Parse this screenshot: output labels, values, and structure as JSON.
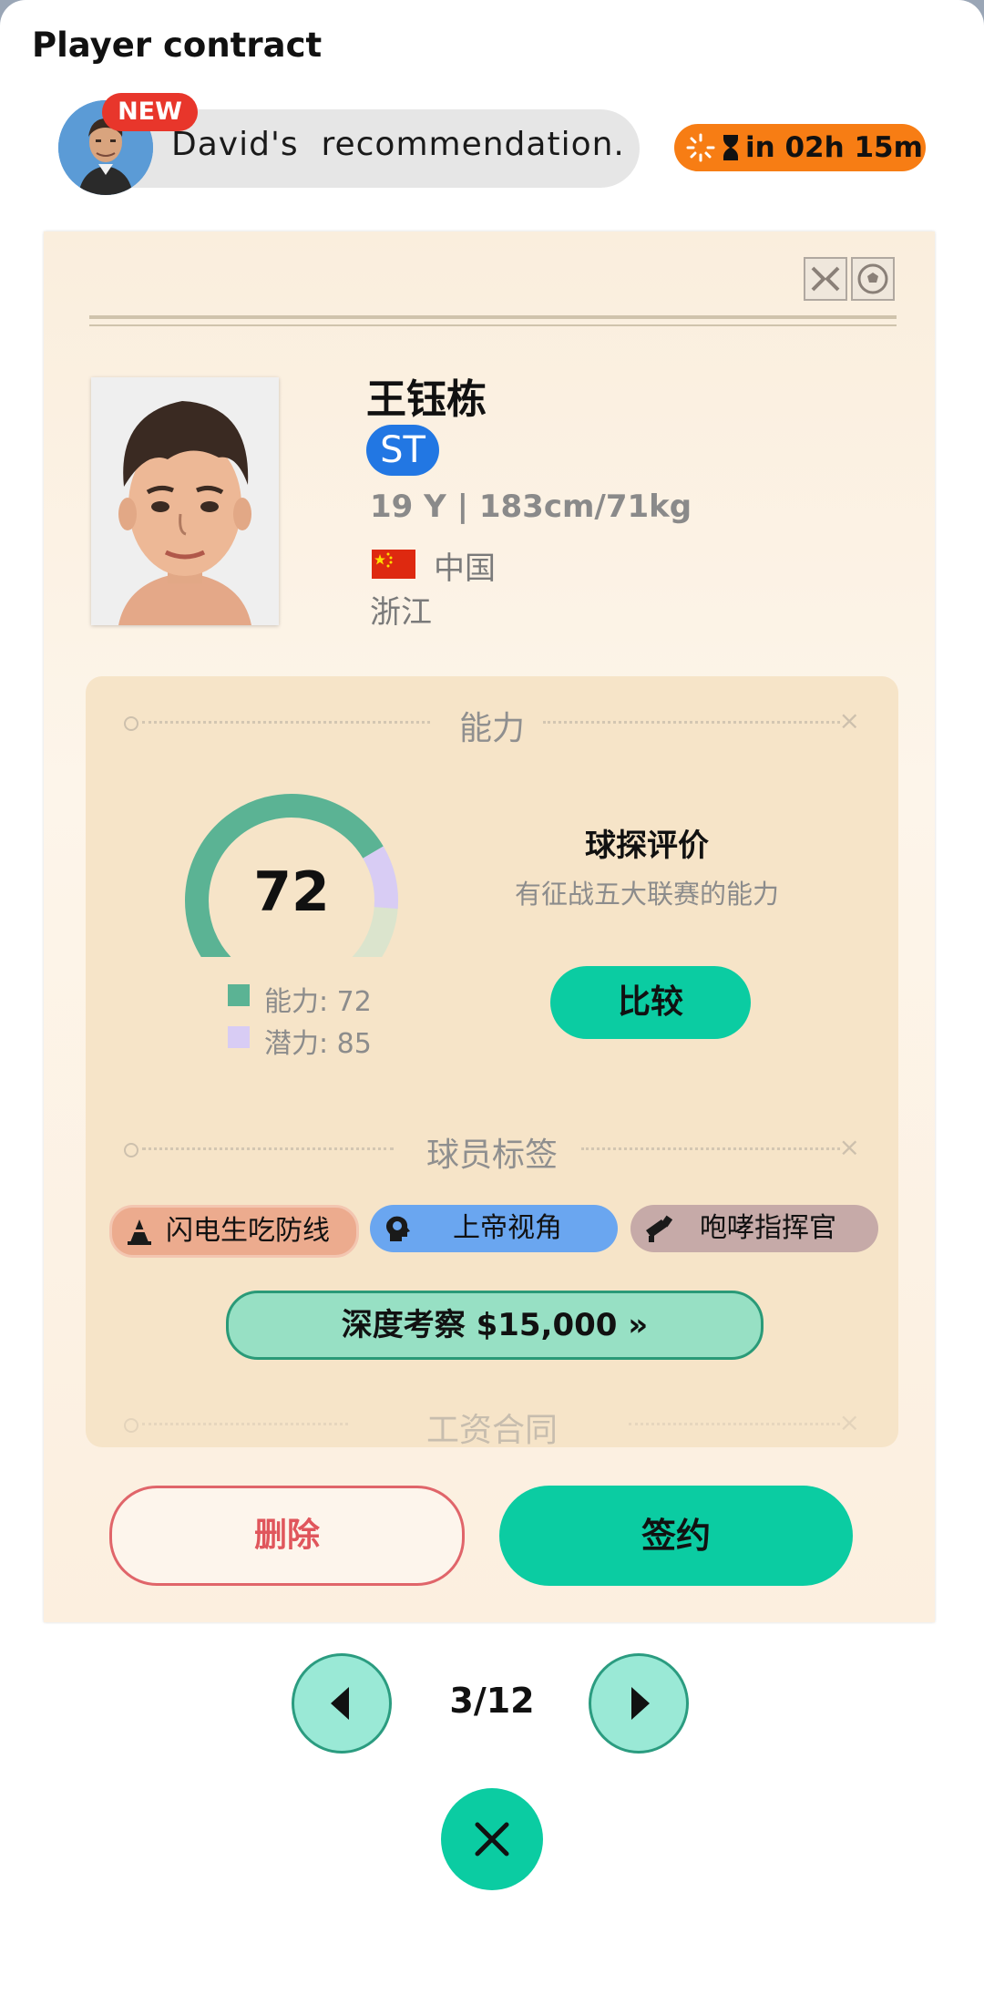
{
  "header": {
    "title": "Player contract"
  },
  "recommendation": {
    "badge": "NEW",
    "text": "David's  recommendation.",
    "timer_text": "in 02h 15m"
  },
  "player": {
    "name": "王钰栋",
    "position": "ST",
    "info": "19 Y | 183cm/71kg",
    "country": "中国",
    "region": "浙江"
  },
  "ability": {
    "section_title": "能力",
    "score": "72",
    "ability_legend": "能力: 72",
    "potential_legend": "潜力: 85",
    "ability_value": 72,
    "potential_value": 85,
    "colors": {
      "ability": "#5bb394",
      "potential": "#d8ccf4",
      "track": "#dbe4cd"
    },
    "scout_title": "球探评价",
    "scout_text": "有征战五大联赛的能力",
    "compare_label": "比较"
  },
  "tags": {
    "section_title": "球员标签",
    "items": [
      {
        "label": "闪电生吃防线",
        "icon": "cone-icon",
        "color": "#e8a080"
      },
      {
        "label": "上帝视角",
        "icon": "head-brain-icon",
        "color": "#6aa6f0"
      },
      {
        "label": "咆哮指挥官",
        "icon": "megaphone-icon",
        "color": "#c6aaa8"
      }
    ],
    "deep_scout_label": "深度考察 $15,000 »"
  },
  "salary": {
    "section_title": "工资合同"
  },
  "actions": {
    "delete_label": "删除",
    "sign_label": "签约"
  },
  "pagination": {
    "indicator": "3/12"
  }
}
